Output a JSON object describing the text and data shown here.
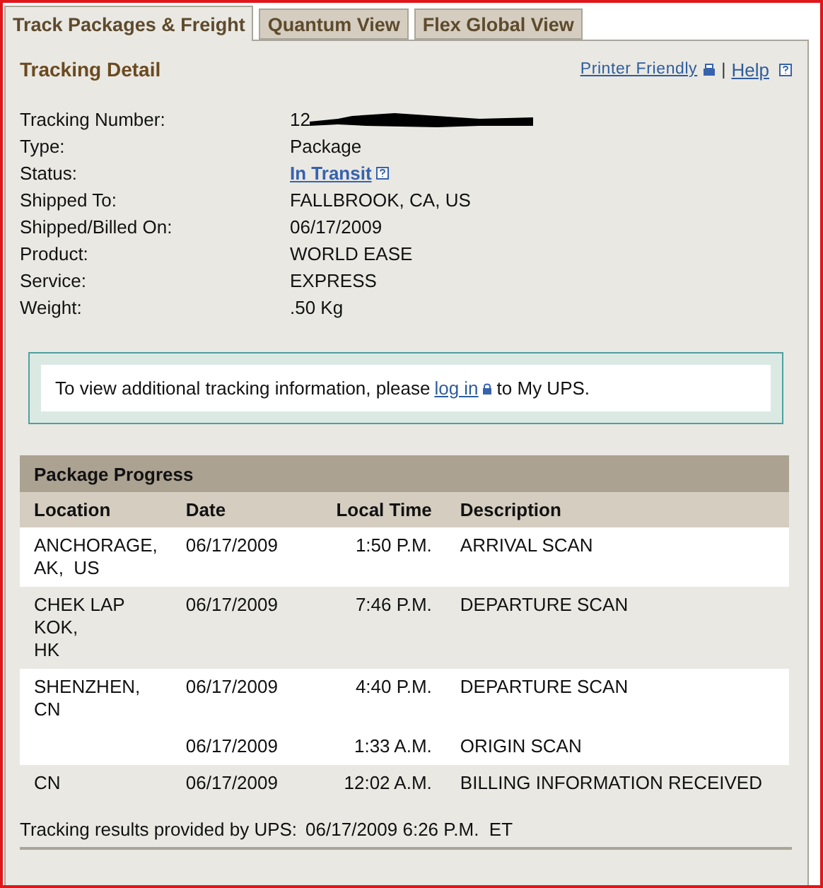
{
  "tabs": [
    {
      "label": "Track Packages & Freight",
      "selected": true
    },
    {
      "label": "Quantum View",
      "selected": false
    },
    {
      "label": "Flex Global View",
      "selected": false
    }
  ],
  "header": {
    "title": "Tracking Detail",
    "printer_link": "Printer Friendly",
    "separator": "|",
    "help_link": "Help"
  },
  "details": [
    {
      "label": "Tracking Number:",
      "value": "12",
      "kind": "redacted"
    },
    {
      "label": "Type:",
      "value": "Package",
      "kind": "text"
    },
    {
      "label": "Status:",
      "value": "In Transit",
      "kind": "link"
    },
    {
      "label": "Shipped To:",
      "value": "FALLBROOK, CA, US",
      "kind": "text"
    },
    {
      "label": "Shipped/Billed On:",
      "value": "06/17/2009",
      "kind": "text"
    },
    {
      "label": "Product:",
      "value": "WORLD EASE",
      "kind": "text"
    },
    {
      "label": "Service:",
      "value": "EXPRESS",
      "kind": "text"
    },
    {
      "label": "Weight:",
      "value": ".50 Kg",
      "kind": "text"
    }
  ],
  "notice": {
    "before": "To view additional tracking information, please",
    "link": "log in",
    "after": "to My UPS."
  },
  "progress": {
    "title": "Package Progress",
    "columns": [
      "Location",
      "Date",
      "Local Time",
      "Description"
    ],
    "rows": [
      {
        "location": "ANCHORAGE,\nAK,  US",
        "date": "06/17/2009",
        "time": "1:50 P.M.",
        "description": "ARRIVAL SCAN",
        "shaded": false
      },
      {
        "location": "CHEK LAP\nKOK,\nHK",
        "date": "06/17/2009",
        "time": "7:46 P.M.",
        "description": "DEPARTURE SCAN",
        "shaded": true
      },
      {
        "location": "SHENZHEN,\nCN",
        "date": "06/17/2009",
        "time": "4:40 P.M.",
        "description": "DEPARTURE SCAN",
        "shaded": false
      },
      {
        "location": "",
        "date": "06/17/2009",
        "time": "1:33 A.M.",
        "description": "ORIGIN SCAN",
        "shaded": false
      },
      {
        "location": "CN",
        "date": "06/17/2009",
        "time": "12:02 A.M.",
        "description": "BILLING INFORMATION RECEIVED",
        "shaded": true
      }
    ]
  },
  "footer": {
    "label": "Tracking results provided by UPS:",
    "timestamp": "06/17/2009 6:26 P.M.  ET"
  }
}
